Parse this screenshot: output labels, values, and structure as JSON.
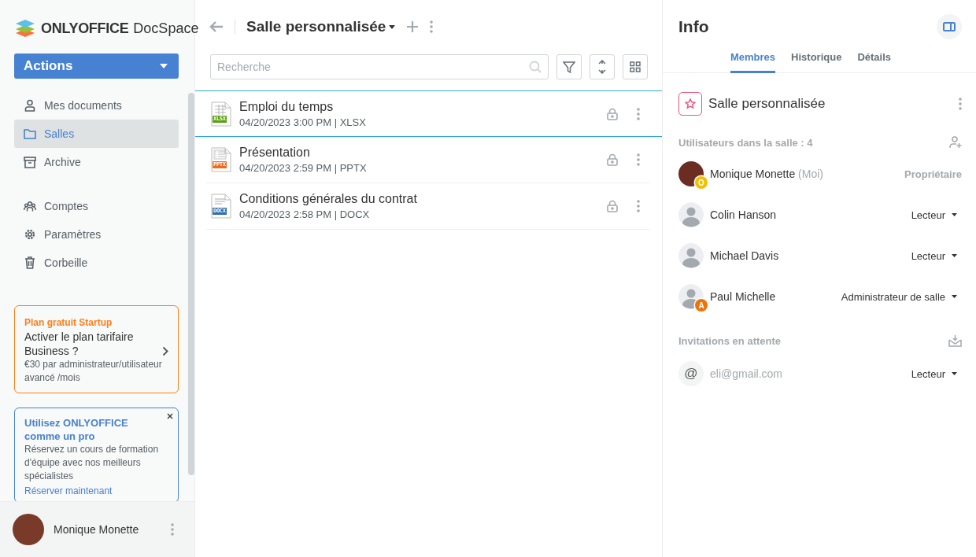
{
  "logo": {
    "brand": "ONLYOFFICE",
    "product": "DocSpace"
  },
  "actions_button": {
    "label": "Actions"
  },
  "sidebar": {
    "groups": [
      {
        "items": [
          {
            "label": "Mes documents",
            "selected": false
          },
          {
            "label": "Salles",
            "selected": true
          },
          {
            "label": "Archive",
            "selected": false
          }
        ]
      },
      {
        "items": [
          {
            "label": "Comptes",
            "selected": false
          },
          {
            "label": "Paramètres",
            "selected": false
          },
          {
            "label": "Corbeille",
            "selected": false
          }
        ]
      }
    ]
  },
  "promo_card": {
    "overline": "Plan gratuit Startup",
    "title": "Activer le plan tarifaire Business ?",
    "text": "€30 par administrateur/utilisateur avancé /mois"
  },
  "tip_card": {
    "title": "Utilisez ONLYOFFICE comme un pro",
    "text": "Réservez un cours de formation d'équipe avec nos meilleurs spécialistes",
    "link": "Réserver maintenant"
  },
  "profile": {
    "name": "Monique Monette"
  },
  "header": {
    "title": "Salle personnalisée"
  },
  "search": {
    "placeholder": "Recherche"
  },
  "files": [
    {
      "kind": "spreadsheet",
      "badge": "XLSX",
      "name": "Emploi du temps",
      "meta": "04/20/2023 3:00 PM | XLSX",
      "selected": true
    },
    {
      "kind": "presentation",
      "badge": "PPTX",
      "name": "Présentation",
      "meta": "04/20/2023 2:59 PM | PPTX",
      "selected": false
    },
    {
      "kind": "document",
      "badge": "DOCX",
      "name": "Conditions générales du contrat",
      "meta": "04/20/2023 2:58 PM | DOCX",
      "selected": false
    }
  ],
  "info": {
    "title": "Info",
    "tabs": [
      {
        "label": "Membres",
        "selected": true
      },
      {
        "label": "Historique",
        "selected": false
      },
      {
        "label": "Détails",
        "selected": false
      }
    ],
    "room": {
      "name": "Salle personnalisée"
    },
    "members_heading": "Utilisateurs dans la salle : 4",
    "members": [
      {
        "kind": "photo",
        "name": "Monique Monette",
        "suffix": "(Moi)",
        "role": "Propriétaire",
        "role_editable": false,
        "badge": "O",
        "color": "#f2c000"
      },
      {
        "kind": "default",
        "name": "Colin Hanson",
        "role": "Lecteur",
        "role_editable": true
      },
      {
        "kind": "default",
        "name": "Michael Davis",
        "role": "Lecteur",
        "role_editable": true
      },
      {
        "kind": "default",
        "name": "Paul Michelle",
        "role": "Administrateur de salle",
        "role_editable": true,
        "badge": "A",
        "color": "#ed7309"
      }
    ],
    "invitations_heading": "Invitations en attente",
    "invitations": [
      {
        "avatar_glyph": "@",
        "email": "eli@gmail.com",
        "role": "Lecteur",
        "role_editable": true
      }
    ]
  }
}
